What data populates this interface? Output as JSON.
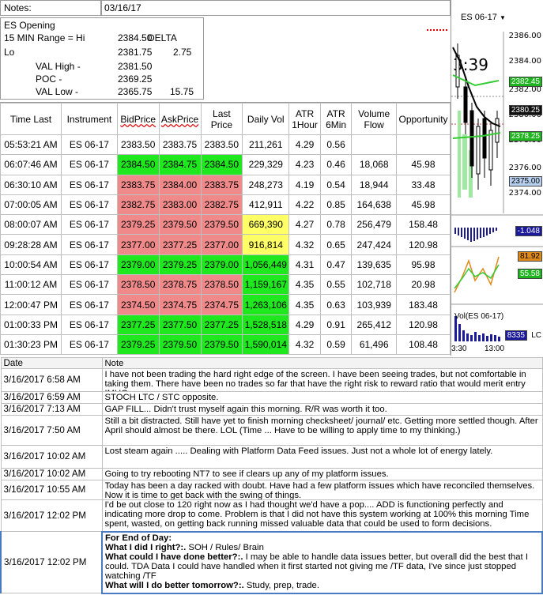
{
  "header": {
    "notes_label": "Notes:",
    "date": "03/16/17",
    "lines": [
      {
        "label": "ES Opening",
        "val": "",
        "extra": ""
      },
      {
        "label": "15 MIN Range = Hi",
        "val": "2384.50",
        "extra": "DELTA"
      },
      {
        "label": "Lo",
        "val": "2381.75",
        "extra": "2.75"
      },
      {
        "label": "VAL High  -",
        "val": "2381.50",
        "extra": ""
      },
      {
        "label": "POC  -",
        "val": "2369.25",
        "extra": ""
      },
      {
        "label": "VAL Low  -",
        "val": "2365.75",
        "extra": "15.75"
      }
    ]
  },
  "columns": [
    "Time Last",
    "Instrument",
    "BidPrice",
    "AskPrice",
    "Last Price",
    "Daily Vol",
    "ATR 1Hour",
    "ATR 6Min",
    "Volume Flow",
    "Opportunity"
  ],
  "rows": [
    {
      "time": "05:53:21 AM",
      "inst": "ES 06-17",
      "bid": "2383.50",
      "ask": "2383.75",
      "last": "2383.50",
      "vol": "211,261",
      "atr1": "4.29",
      "atr6": "0.56",
      "flow": "",
      "opp": "",
      "pc": "",
      "vc": ""
    },
    {
      "time": "06:07:46 AM",
      "inst": "ES 06-17",
      "bid": "2384.50",
      "ask": "2384.75",
      "last": "2384.50",
      "vol": "229,329",
      "atr1": "4.23",
      "atr6": "0.46",
      "flow": "18,068",
      "opp": "45.98",
      "pc": "green",
      "vc": ""
    },
    {
      "time": "06:30:10 AM",
      "inst": "ES 06-17",
      "bid": "2383.75",
      "ask": "2384.00",
      "last": "2383.75",
      "vol": "248,273",
      "atr1": "4.19",
      "atr6": "0.54",
      "flow": "18,944",
      "opp": "33.48",
      "pc": "red",
      "vc": ""
    },
    {
      "time": "07:00:05 AM",
      "inst": "ES 06-17",
      "bid": "2382.75",
      "ask": "2383.00",
      "last": "2382.75",
      "vol": "412,911",
      "atr1": "4.22",
      "atr6": "0.85",
      "flow": "164,638",
      "opp": "45.98",
      "pc": "red",
      "vc": ""
    },
    {
      "time": "08:00:07 AM",
      "inst": "ES 06-17",
      "bid": "2379.25",
      "ask": "2379.50",
      "last": "2379.50",
      "vol": "669,390",
      "atr1": "4.27",
      "atr6": "0.78",
      "flow": "256,479",
      "opp": "158.48",
      "pc": "red",
      "vc": "yellow"
    },
    {
      "time": "09:28:28 AM",
      "inst": "ES 06-17",
      "bid": "2377.00",
      "ask": "2377.25",
      "last": "2377.00",
      "vol": "916,814",
      "atr1": "4.32",
      "atr6": "0.65",
      "flow": "247,424",
      "opp": "120.98",
      "pc": "red",
      "vc": "yellow"
    },
    {
      "time": "10:00:54 AM",
      "inst": "ES 06-17",
      "bid": "2379.00",
      "ask": "2379.25",
      "last": "2379.00",
      "vol": "1,056,449",
      "atr1": "4.31",
      "atr6": "0.47",
      "flow": "139,635",
      "opp": "95.98",
      "pc": "green",
      "vc": "green"
    },
    {
      "time": "11:00:12 AM",
      "inst": "ES 06-17",
      "bid": "2378.50",
      "ask": "2378.75",
      "last": "2378.50",
      "vol": "1,159,167",
      "atr1": "4.35",
      "atr6": "0.55",
      "flow": "102,718",
      "opp": "20.98",
      "pc": "red",
      "vc": "green"
    },
    {
      "time": "12:00:47 PM",
      "inst": "ES 06-17",
      "bid": "2374.50",
      "ask": "2374.75",
      "last": "2374.75",
      "vol": "1,263,106",
      "atr1": "4.35",
      "atr6": "0.63",
      "flow": "103,939",
      "opp": "183.48",
      "pc": "red",
      "vc": "green"
    },
    {
      "time": "01:00:33 PM",
      "inst": "ES 06-17",
      "bid": "2377.25",
      "ask": "2377.50",
      "last": "2377.25",
      "vol": "1,528,518",
      "atr1": "4.29",
      "atr6": "0.91",
      "flow": "265,412",
      "opp": "120.98",
      "pc": "green",
      "vc": "green"
    },
    {
      "time": "01:30:23 PM",
      "inst": "ES 06-17",
      "bid": "2379.25",
      "ask": "2379.50",
      "last": "2379.50",
      "vol": "1,590,014",
      "atr1": "4.32",
      "atr6": "0.59",
      "flow": "61,496",
      "opp": "108.48",
      "pc": "green",
      "vc": "green"
    }
  ],
  "chart": {
    "instrument": "ES 06-17",
    "clock": "3:39",
    "y_labels": [
      "2386.00",
      "2384.00",
      "2382.00",
      "2380.00",
      "2378.00",
      "2376.00",
      "2374.00"
    ],
    "tags": [
      "2382.45",
      "2380.25",
      "2378.25",
      "2375.00"
    ],
    "ind_tags": [
      "-1.048",
      "81.92",
      "55.58",
      "8335"
    ],
    "vol_label": "Vol(ES 06-17)",
    "lc": "LC",
    "x_labels": [
      "3:30",
      "13:00"
    ]
  },
  "notes": {
    "col_date": "Date",
    "col_note": "Note",
    "items": [
      {
        "date": "3/16/2017 6:58 AM",
        "text": "I have not been trading the hard right edge of the screen.  I have been seeing trades, but not comfortable in taking them.  There have been no trades so far that have the right risk to reward ratio that would merit entry IMHO."
      },
      {
        "date": "3/16/2017 6:59 AM",
        "text": "STOCH LTC / STC opposite."
      },
      {
        "date": "3/16/2017 7:13 AM",
        "text": "GAP FILL... Didn't trust myself again this morning.  R/R was worth it too."
      },
      {
        "date": "3/16/2017 7:50 AM",
        "text": "Still a bit distracted.  Still have yet to finish morning checksheet/ journal/ etc.  Getting more settled though.  After April should almost be there. LOL (Time ... Have to be willing to apply time to my thinking.)"
      },
      {
        "date": "3/16/2017 10:02 AM",
        "text": "Lost steam again ..... Dealing with Platform Data Feed issues.  Just not a whole lot of energy lately."
      },
      {
        "date": "3/16/2017 10:02 AM",
        "text": "Going to try rebooting NT7 to see if clears up any of my platform issues."
      },
      {
        "date": "3/16/2017 10:55 AM",
        "text": "Today has been a day racked with doubt.  Have had a few platform issues which have reconciled themselves.  Now it is time to get back with the swing of things."
      },
      {
        "date": "3/16/2017 12:02 PM",
        "text": "I'd be out close to 120 right now as I had thought we'd have a pop.... ADD is functioning perfectly and indicating more drop to come.  Problem is that I did not have this system working at 100% this morning  Time spent, wasted, on getting back running missed valuable data that could be used to form decisions."
      }
    ],
    "final": {
      "date": "3/16/2017 12:02 PM",
      "l1": "For End of Day:",
      "l2b": "What I did I right?:.",
      "l2": "  SOH / Rules/ Brain",
      "l3b": "What could I have done better?:.",
      "l3": "  I may be able to handle data issues better, but overall did the best that I could.  TDA Data I could have handled when it first started not giving me /TF data, I've since just stopped watching /TF",
      "l4b": "What will I do better tomorrow?:.",
      "l4": "  Study, prep, trade."
    }
  }
}
